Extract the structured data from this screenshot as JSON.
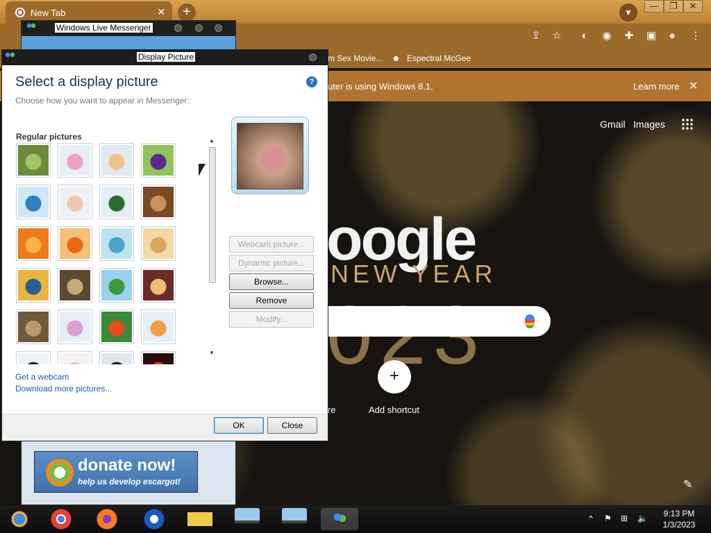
{
  "chrome": {
    "tab_title": "New Tab",
    "bookmarks": [
      "m Sex Movie...",
      "Espectral McGee"
    ],
    "infobar_message": "uter is using Windows 8.1.",
    "infobar_learn_more": "Learn more",
    "ntp": {
      "gmail": "Gmail",
      "images": "Images",
      "logo_fragment": "oogle",
      "new_year": "NEW YEAR",
      "year_fragment": "023",
      "add_shortcut": "Add shortcut",
      "shortcut_fragment": "re"
    }
  },
  "messenger": {
    "title": "Windows Live Messenger",
    "donate_title": "donate now!",
    "donate_subtitle": "help us develop escargot!"
  },
  "dialog": {
    "title": "Display Picture",
    "heading": "Select a display picture",
    "subheading": "Choose how you want to appear in Messenger:",
    "group_label": "Regular pictures",
    "pictures": [
      "bamboo",
      "surfer",
      "tennis",
      "gamer-girl",
      "soccer-player",
      "chef",
      "businessman",
      "suitcase",
      "gerbera-daisy",
      "goldfish",
      "beach",
      "sand-dune",
      "bass-clef",
      "chess",
      "soccer-field",
      "skater",
      "kitten",
      "guitar-player",
      "sports-balls",
      "gifts",
      "ninja",
      "ghost",
      "horse",
      "fireworks"
    ],
    "buttons": {
      "webcam": "Webcam picture...",
      "dynamic": "Dynamic picture...",
      "browse": "Browse...",
      "remove": "Remove",
      "modify": "Modify..."
    },
    "links": {
      "get_webcam": "Get a webcam",
      "download_more": "Download more pictures..."
    },
    "ok": "OK",
    "close": "Close"
  },
  "taskbar": {
    "apps": [
      "Windows Live Messenger",
      "Google Chrome",
      "Firefox",
      "Escargot",
      "File Explorer",
      "Remote Desktop",
      "Remote Desktop",
      "Messenger"
    ],
    "time": "9:13 PM",
    "date": "1/3/2023"
  },
  "colors": {
    "chrome_theme": "#9c6b2c",
    "dialog_heading": "#1e3350",
    "link": "#1a5ba8",
    "taskbar": "#121212"
  }
}
